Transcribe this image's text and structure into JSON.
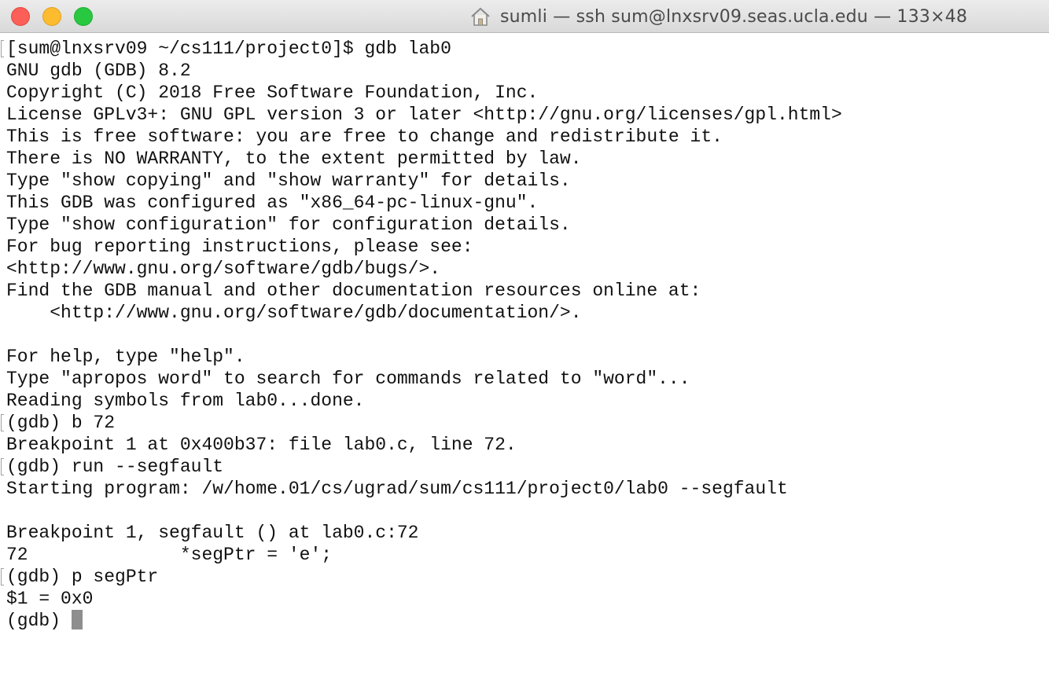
{
  "window": {
    "title": "sumli — ssh sum@lnxsrv09.seas.ucla.edu — 133×48",
    "title_icon": "home-icon"
  },
  "terminal": {
    "lines": [
      "[sum@lnxsrv09 ~/cs111/project0]$ gdb lab0",
      "GNU gdb (GDB) 8.2",
      "Copyright (C) 2018 Free Software Foundation, Inc.",
      "License GPLv3+: GNU GPL version 3 or later <http://gnu.org/licenses/gpl.html>",
      "This is free software: you are free to change and redistribute it.",
      "There is NO WARRANTY, to the extent permitted by law.",
      "Type \"show copying\" and \"show warranty\" for details.",
      "This GDB was configured as \"x86_64-pc-linux-gnu\".",
      "Type \"show configuration\" for configuration details.",
      "For bug reporting instructions, please see:",
      "<http://www.gnu.org/software/gdb/bugs/>.",
      "Find the GDB manual and other documentation resources online at:",
      "    <http://www.gnu.org/software/gdb/documentation/>.",
      "",
      "For help, type \"help\".",
      "Type \"apropos word\" to search for commands related to \"word\"...",
      "Reading symbols from lab0...done.",
      "(gdb) b 72",
      "Breakpoint 1 at 0x400b37: file lab0.c, line 72.",
      "(gdb) run --segfault",
      "Starting program: /w/home.01/cs/ugrad/sum/cs111/project0/lab0 --segfault",
      "",
      "Breakpoint 1, segfault () at lab0.c:72",
      "72\t\t*segPtr = 'e';",
      "(gdb) p segPtr",
      "$1 = 0x0",
      "(gdb) "
    ]
  },
  "colors": {
    "close": "#fc5f57",
    "minimize": "#fdbc2e",
    "zoom": "#28c840",
    "cursor": "#8e8e8e"
  }
}
